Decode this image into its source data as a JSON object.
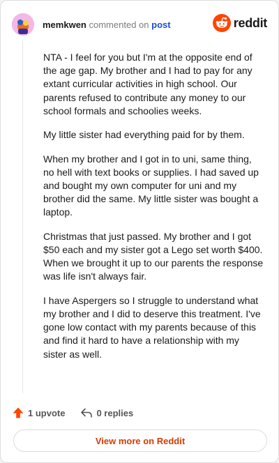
{
  "header": {
    "username": "memkwen",
    "commented_text": "commented on",
    "post_link": "post",
    "brand": "reddit"
  },
  "comment": {
    "paragraphs": [
      "NTA - I feel for you but I'm at the opposite end of the age gap. My brother and I had to pay for any extant curricular activities in high school. Our parents refused to contribute any money to our school formals and schoolies weeks.",
      "My little sister had everything paid for by them.",
      "When my brother and I got in to uni, same thing, no hell with text books or supplies. I had saved up and bought my own computer for uni and my brother did the same. My little sister was bought a laptop.",
      "Christmas that just passed. My brother and I got $50 each and my sister got a Lego set worth $400. When we brought it up to our parents the response was life isn't always fair.",
      "I have Aspergers so I struggle to understand what my brother and I did to deserve this treatment. I've gone low contact with my parents because of this and find it hard to have a relationship with my sister as well."
    ]
  },
  "actions": {
    "upvote_label": "1 upvote",
    "replies_label": "0 replies"
  },
  "footer": {
    "view_more_label": "View more on Reddit"
  },
  "colors": {
    "accent": "#ff4500",
    "link": "#1d4ed8",
    "view_more": "#d93a00"
  },
  "icons": {
    "avatar": "user-avatar",
    "brand": "reddit-snoo-icon",
    "upvote": "upvote-arrow-icon",
    "reply": "reply-arrow-icon"
  }
}
